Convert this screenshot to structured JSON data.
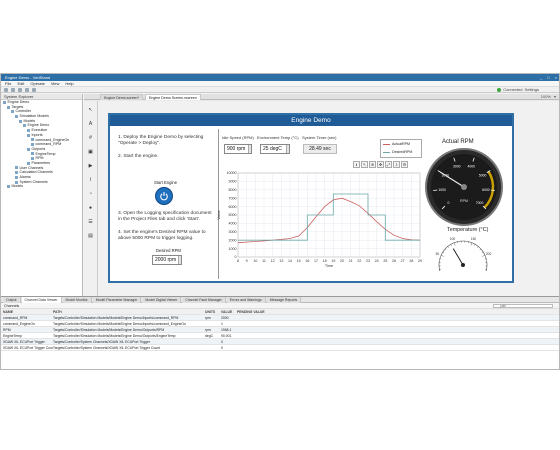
{
  "window": {
    "title": "Engine Demo - VeriStand",
    "controls": [
      "_",
      "□",
      "×"
    ]
  },
  "menu": [
    "File",
    "Edit",
    "Operate",
    "View",
    "Help"
  ],
  "connection": {
    "status": "Connected",
    "settings": "Settings"
  },
  "tree": {
    "header": "System Explorer",
    "items": [
      {
        "label": "Engine Demo",
        "indent": 0
      },
      {
        "label": "Targets",
        "indent": 1
      },
      {
        "label": "Controller",
        "indent": 2
      },
      {
        "label": "Simulation Models",
        "indent": 3
      },
      {
        "label": "Models",
        "indent": 4
      },
      {
        "label": "Engine Demo",
        "indent": 5
      },
      {
        "label": "Execution",
        "indent": 6
      },
      {
        "label": "Inports",
        "indent": 6
      },
      {
        "label": "command_EngineOn",
        "indent": 7
      },
      {
        "label": "command_RPM",
        "indent": 7
      },
      {
        "label": "Outports",
        "indent": 6
      },
      {
        "label": "EngineTemp",
        "indent": 7
      },
      {
        "label": "RPM",
        "indent": 7
      },
      {
        "label": "Parameters",
        "indent": 6
      },
      {
        "label": "User Channels",
        "indent": 3
      },
      {
        "label": "Calculated Channels",
        "indent": 3
      },
      {
        "label": "Alarms",
        "indent": 3
      },
      {
        "label": "System Channels",
        "indent": 3
      },
      {
        "label": "Models",
        "indent": 1
      }
    ]
  },
  "tabs": [
    {
      "label": "Engine Demo.screen*",
      "active": false
    },
    {
      "label": "Engine Demo Screen.vscreen",
      "active": true
    }
  ],
  "tabright": {
    "zoom": "100%",
    "more": "▾"
  },
  "demo": {
    "title": "Engine Demo",
    "steps": [
      "1. Deploy the Engine Demo by selecting \"Operate > Deploy\".",
      "2. Start the engine.",
      "3. Open the Logging specification document in the Project Files tab and click 'Start'.",
      "4. Set the engine's Desired RPM value to above 5000 RPM to trigger logging."
    ],
    "start_label": "Start Engine",
    "desired_rpm": {
      "label": "Desired RPM",
      "value": "2000 rpm"
    },
    "idle_speed": {
      "label": "Idle Speed (RPM)",
      "value": "900 rpm"
    },
    "env_temp": {
      "label": "Environment Temp (°C)",
      "value": "25 degC"
    },
    "sys_time": {
      "label": "System Timer (sec)",
      "value": "28.49 sec"
    },
    "rpm_title": "Actual RPM",
    "temp_title": "Temperature (°C)",
    "gauge_unit": "RPM"
  },
  "chart_data": {
    "type": "line",
    "xlabel": "Time",
    "ylabel": "Value",
    "xlim": [
      8,
      29
    ],
    "ylim": [
      0,
      10000
    ],
    "x_ticks": [
      8,
      9,
      10,
      11,
      12,
      13,
      14,
      15,
      16,
      17,
      18,
      19,
      20,
      21,
      22,
      23,
      24,
      25,
      26,
      27,
      28,
      29
    ],
    "y_ticks": [
      0,
      1000,
      2000,
      3000,
      4000,
      5000,
      6000,
      7000,
      8000,
      9000,
      10000
    ],
    "legend": "top-right",
    "series": [
      {
        "name": "ActualRPM",
        "color": "#d06060",
        "x": [
          8,
          10,
          12,
          14,
          15,
          16,
          17,
          18,
          19,
          20,
          21,
          22,
          23,
          24,
          25,
          26,
          27,
          28,
          29
        ],
        "y": [
          1700,
          1850,
          2000,
          2200,
          2500,
          3500,
          4800,
          6000,
          6800,
          7000,
          6600,
          6100,
          5200,
          4200,
          3300,
          2600,
          2200,
          2050,
          2000
        ]
      },
      {
        "name": "DesiredRPM",
        "color": "#6aa6a6",
        "x": [
          8,
          16,
          16,
          19,
          19,
          23,
          23,
          25,
          25,
          29
        ],
        "y": [
          2000,
          2000,
          5000,
          5000,
          7500,
          7500,
          5000,
          5000,
          2000,
          2000
        ]
      }
    ]
  },
  "rpm_gauge": {
    "min": 0,
    "max": 7000,
    "value": 2000,
    "ticks": [
      "0",
      "1000",
      "2000",
      "3000",
      "4000",
      "5000",
      "6000",
      "7000"
    ]
  },
  "temp_gauge": {
    "min": 0,
    "max": 250,
    "value": 90,
    "ticks": [
      "0",
      "50",
      "100",
      "150",
      "200",
      "250"
    ]
  },
  "bottom": {
    "tabs": [
      {
        "label": "Output",
        "active": false
      },
      {
        "label": "Channel Data Viewer",
        "active": true
      },
      {
        "label": "Model Monitor",
        "active": false
      },
      {
        "label": "Model Parameter Manager",
        "active": false
      },
      {
        "label": "Model Digital Viewer",
        "active": false
      },
      {
        "label": "Channel Fault Manager",
        "active": false
      },
      {
        "label": "Errors and Warnings",
        "active": false
      },
      {
        "label": "Message Reports",
        "active": false
      }
    ],
    "toolbar": "Channels",
    "filter_placeholder": "path",
    "columns": [
      "NAME",
      "PATH",
      "UNITS",
      "VALUE",
      "PENDING VALUE"
    ],
    "rows": [
      [
        "command_RPM",
        "Targets/Controller/Simulation Models/Models/Engine Demo/Inports/command_RPM",
        "rpm",
        "2000",
        ""
      ],
      [
        "command_EngineOn",
        "Targets/Controller/Simulation Models/Models/Engine Demo/Inports/command_EngineOn",
        "",
        "1",
        ""
      ],
      [
        "RPM",
        "Targets/Controller/Simulation Models/Models/Engine Demo/Outports/RPM",
        "rpm",
        "1968.1",
        ""
      ],
      [
        "EngineTemp",
        "Targets/Controller/Simulation Models/Models/Engine Demo/Outports/EngineTemp",
        "degC",
        "90.001",
        ""
      ],
      [
        "XDAW XIL ECUPort Trigger",
        "Targets/Controller/System Channels/XDAW XIL ECUPort Trigger",
        "",
        "0",
        ""
      ],
      [
        "XDAW XIL ECUPort Trigger Count",
        "Targets/Controller/System Channels/XDAW XIL ECUPort Trigger Count",
        "",
        "0",
        ""
      ]
    ]
  }
}
